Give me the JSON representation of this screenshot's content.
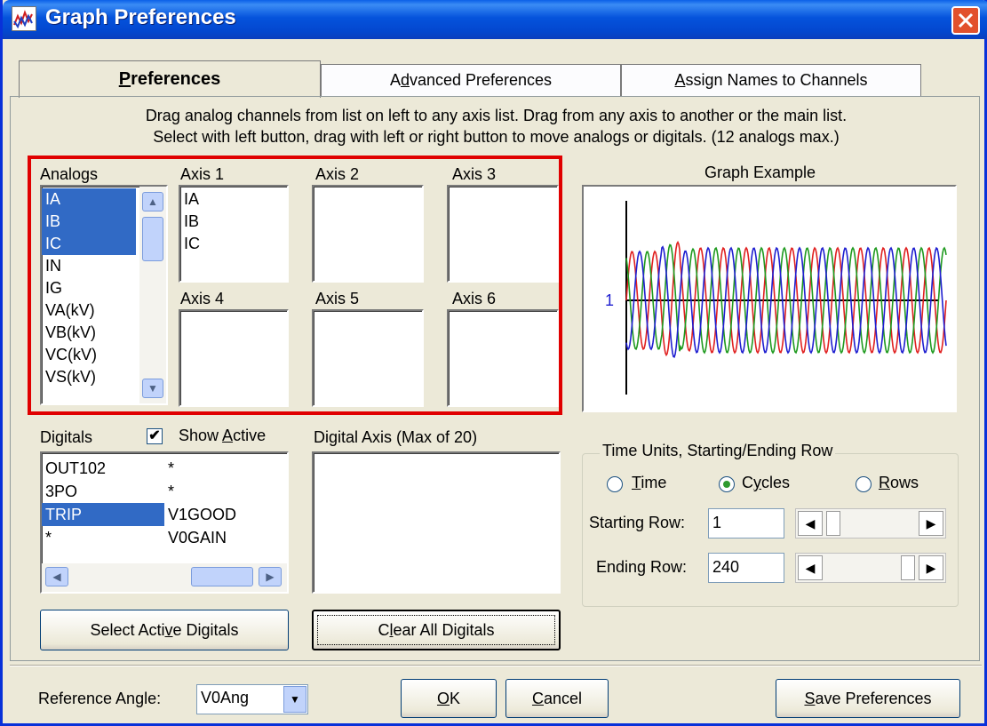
{
  "window": {
    "title": "Graph Preferences"
  },
  "tabs": [
    {
      "label": "Preferences",
      "accel": "P",
      "rest": "references",
      "active": true
    },
    {
      "label": "Advanced Preferences",
      "pre": "A",
      "accel": "d",
      "rest": "vanced Preferences"
    },
    {
      "label": "Assign Names to Channels",
      "accel": "A",
      "rest": "ssign Names to Channels"
    }
  ],
  "instructions": [
    "Drag analog channels from list on left to any axis list. Drag from any axis to another or the main list.",
    "Select with left button, drag with left or right button to move analogs or digitals. (12 analogs max.)"
  ],
  "analogs": {
    "label": "Analogs",
    "items": [
      {
        "text": "IA",
        "selected": true
      },
      {
        "text": "IB",
        "selected": true
      },
      {
        "text": "IC",
        "selected": true
      },
      {
        "text": "IN",
        "selected": false
      },
      {
        "text": "IG",
        "selected": false
      },
      {
        "text": "VA(kV)",
        "selected": false
      },
      {
        "text": "VB(kV)",
        "selected": false
      },
      {
        "text": "VC(kV)",
        "selected": false
      },
      {
        "text": "VS(kV)",
        "selected": false
      }
    ]
  },
  "axes": [
    {
      "label": "Axis 1",
      "items": [
        "IA",
        "IB",
        "IC"
      ]
    },
    {
      "label": "Axis 2",
      "items": []
    },
    {
      "label": "Axis 3",
      "items": []
    },
    {
      "label": "Axis 4",
      "items": []
    },
    {
      "label": "Axis 5",
      "items": []
    },
    {
      "label": "Axis 6",
      "items": []
    }
  ],
  "graph": {
    "label": "Graph Example",
    "y_tick": "1",
    "colors": {
      "red": "#e02020",
      "green": "#1f9a1f",
      "blue": "#1f1fd0"
    }
  },
  "digitals": {
    "label": "Digitals",
    "show_active_pre": "Show ",
    "show_active_accel": "A",
    "show_active_rest": "ctive",
    "show_active_checked": true,
    "items": [
      {
        "col1": "OUT102",
        "col2": "*",
        "selected": false
      },
      {
        "col1": "3PO",
        "col2": "*",
        "selected": false
      },
      {
        "col1": "TRIP",
        "col2": "V1GOOD",
        "selected": true
      },
      {
        "col1": "*",
        "col2": "V0GAIN",
        "selected": false
      }
    ]
  },
  "digital_axis": {
    "label": "Digital Axis (Max of 20)"
  },
  "buttons": {
    "select_active_pre": "Select Acti",
    "select_active_accel": "v",
    "select_active_rest": "e Digitals",
    "clear_pre": "C",
    "clear_accel": "l",
    "clear_rest": "ear All Digitals",
    "ok_accel": "O",
    "ok_rest": "K",
    "cancel_accel": "C",
    "cancel_rest": "ancel",
    "save_accel": "S",
    "save_rest": "ave Preferences"
  },
  "time_units": {
    "title": "Time Units, Starting/Ending Row",
    "options": [
      {
        "accel": "T",
        "rest": "ime",
        "checked": false
      },
      {
        "pre": "C",
        "accel": "y",
        "rest": "cles",
        "checked": true
      },
      {
        "accel": "R",
        "rest": "ows",
        "checked": false
      }
    ],
    "starting_row_label": "Starting Row:",
    "starting_row_value": "1",
    "ending_row_label": "Ending Row:",
    "ending_row_value": "240"
  },
  "footer": {
    "reference_angle_label": "Reference Angle:",
    "reference_angle_value": "V0Ang"
  }
}
